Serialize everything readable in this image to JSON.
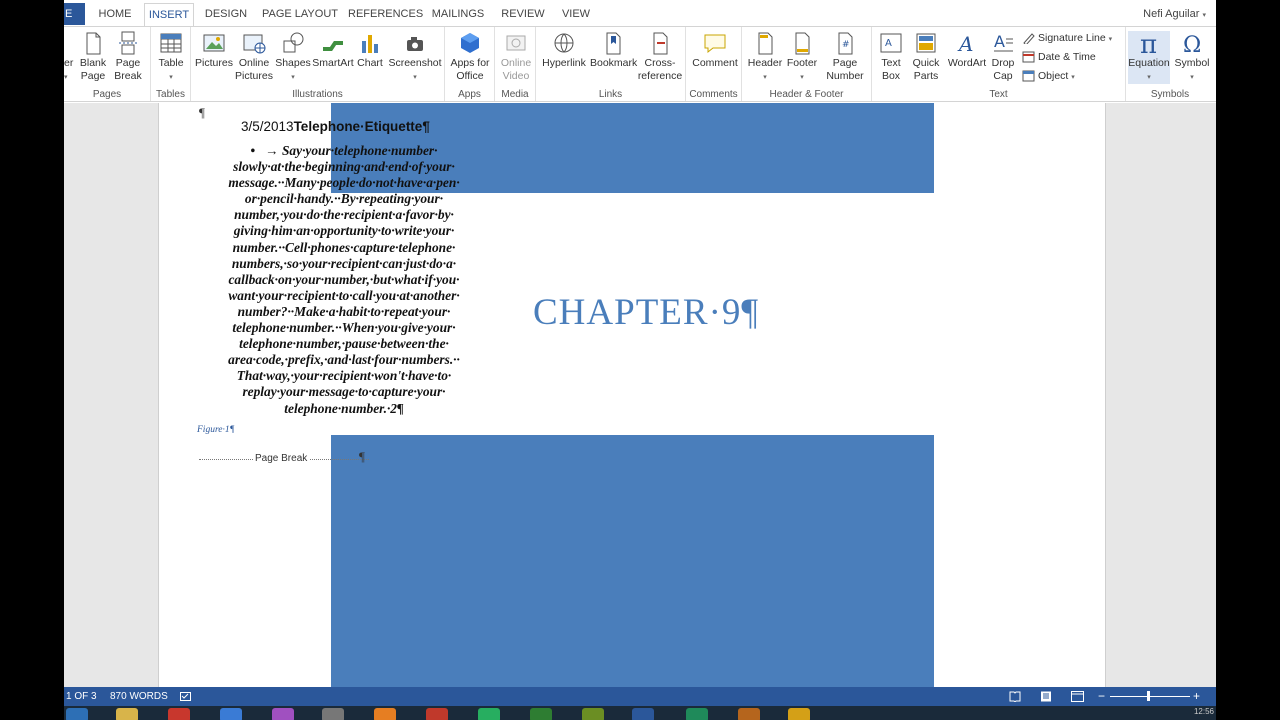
{
  "tabs": {
    "file": "E",
    "items": [
      "HOME",
      "INSERT",
      "DESIGN",
      "PAGE LAYOUT",
      "REFERENCES",
      "MAILINGS",
      "REVIEW",
      "VIEW"
    ],
    "user": "Nefi Aguilar"
  },
  "ribbon": {
    "pages": {
      "label": "Pages",
      "cover": "er",
      "blank_page": "Blank\nPage",
      "page_break": "Page\nBreak"
    },
    "tables": {
      "label": "Tables",
      "table": "Table"
    },
    "illustrations": {
      "label": "Illustrations",
      "pictures": "Pictures",
      "online_pictures": "Online\nPictures",
      "shapes": "Shapes",
      "smartart": "SmartArt",
      "chart": "Chart",
      "screenshot": "Screenshot"
    },
    "apps": {
      "label": "Apps",
      "apps_for_office": "Apps for\nOffice"
    },
    "media": {
      "label": "Media",
      "online_video": "Online\nVideo"
    },
    "links": {
      "label": "Links",
      "hyperlink": "Hyperlink",
      "bookmark": "Bookmark",
      "cross_reference": "Cross-\nreference"
    },
    "comments": {
      "label": "Comments",
      "comment": "Comment"
    },
    "header_footer": {
      "label": "Header & Footer",
      "header": "Header",
      "footer": "Footer",
      "page_number": "Page\nNumber"
    },
    "text": {
      "label": "Text",
      "text_box": "Text\nBox",
      "quick_parts": "Quick\nParts",
      "wordart": "WordArt",
      "drop_cap": "Drop\nCap",
      "signature_line": "Signature Line",
      "date_time": "Date & Time",
      "object": "Object"
    },
    "symbols": {
      "label": "Symbols",
      "equation": "Equation",
      "symbol": "Symbol"
    }
  },
  "document": {
    "para_mark": "¶",
    "heading_date": "3/5/2013",
    "heading_title": "Telephone·Etiquette¶",
    "bullet_marker": "•   →",
    "bullet_lines": [
      "Say·your·telephone·number·",
      "slowly·at·the·beginning·and·end·of·your·",
      "message.··Many·people·do·not·have·a·pen·",
      "or·pencil·handy.··By·repeating·your·",
      "number,·you·do·the·recipient·a·favor·by·",
      "giving·him·an·opportunity·to·write·your·",
      "number.··Cell·phones·capture·telephone·",
      "numbers,·so·your·recipient·can·just·do·a·",
      "callback·on·your·number,·but·what·if·you·",
      "want·your·recipient·to·call·you·at·another·",
      "number?··Make·a·habit·to·repeat·your·",
      "telephone·number.··When·you·give·your·",
      "telephone·number,·pause·between·the·",
      "area·code,·prefix,·and·last·four·numbers.··",
      "That·way,·your·recipient·won't·have·to·",
      "replay·your·message·to·capture·your·",
      "telephone·number.·2¶"
    ],
    "figure_caption": "Figure·1¶",
    "page_break": "Page Break",
    "page_break_mark": "¶",
    "chapter": "CHAPTER·9¶"
  },
  "status": {
    "page": "1 OF 3",
    "words": "870 WORDS",
    "time": "12:56"
  },
  "colors": {
    "accent": "#2b579a",
    "shape_blue": "#4a7ebb"
  }
}
